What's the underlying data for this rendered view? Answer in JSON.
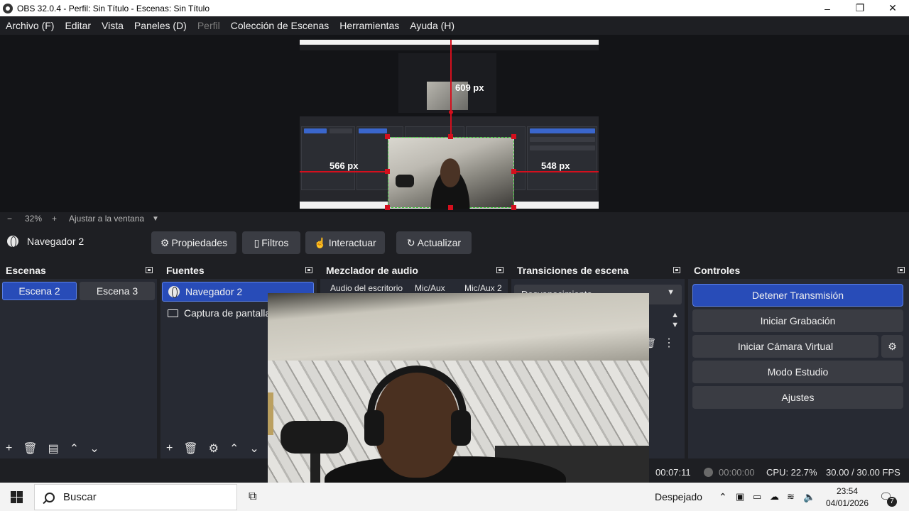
{
  "window": {
    "title": "OBS 32.0.4 - Perfil: Sin Título - Escenas: Sin Título",
    "minimize": "–",
    "maximize": "❐",
    "close": "✕"
  },
  "menu": {
    "items": [
      "Archivo (F)",
      "Editar",
      "Vista",
      "Paneles (D)",
      "Perfil",
      "Colección de Escenas",
      "Herramientas",
      "Ayuda (H)"
    ]
  },
  "preview": {
    "labels": {
      "top": "609 px",
      "left": "566 px",
      "right": "548 px"
    }
  },
  "zoom": {
    "minus": "−",
    "value": "32%",
    "plus": "+",
    "fit": "Ajustar a la ventana",
    "caret": "▼"
  },
  "source_toolbar": {
    "selected_source": "Navegador 2",
    "properties": "Propiedades",
    "filters": "Filtros",
    "interact": "Interactuar",
    "refresh": "Actualizar"
  },
  "scenes": {
    "title": "Escenas",
    "items": [
      "Escena 2",
      "Escena 3"
    ],
    "active_index": 0
  },
  "sources": {
    "title": "Fuentes",
    "items": [
      "Navegador 2",
      "Captura de pantalla"
    ]
  },
  "audio_mixer": {
    "title": "Mezclador de audio",
    "channels": [
      "Audio del escritorio",
      "Mic/Aux",
      "Mic/Aux 2"
    ]
  },
  "transitions": {
    "title": "Transiciones de escena",
    "current": "Desvanecimiento"
  },
  "controls": {
    "title": "Controles",
    "stop_stream": "Detener Transmisión",
    "start_recording": "Iniciar Grabación",
    "start_virtual_cam": "Iniciar Cámara Virtual",
    "studio_mode": "Modo Estudio",
    "settings": "Ajustes"
  },
  "status": {
    "stream_time": "00:07:11",
    "record_time": "00:00:00",
    "cpu": "CPU: 22.7%",
    "fps": "30.00 / 30.00 FPS"
  },
  "taskbar": {
    "search_placeholder": "Buscar",
    "weather": "Despejado",
    "time": "23:54",
    "date": "04/01/2026",
    "notifications": "7"
  },
  "colors": {
    "accent": "#284cb8",
    "guide": "#d40f1d",
    "dock_bg": "#272a33",
    "bg": "#1e1f23"
  }
}
